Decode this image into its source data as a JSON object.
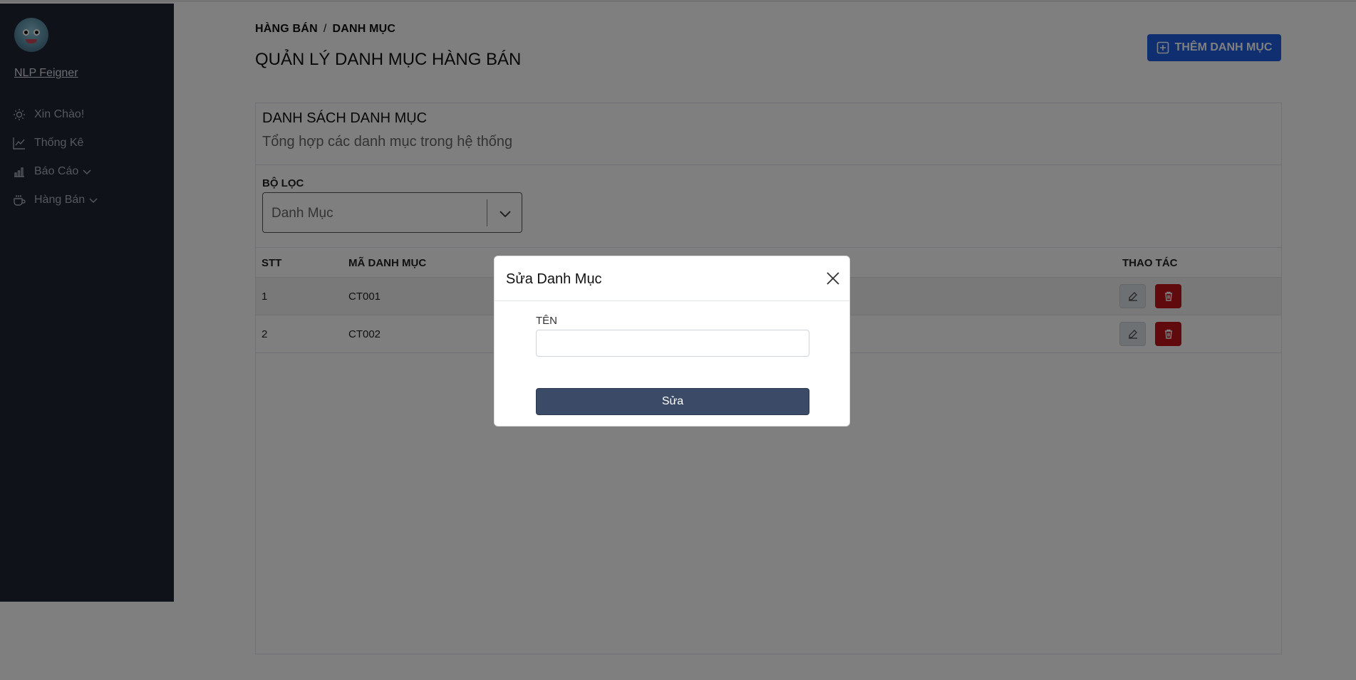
{
  "sidebar": {
    "username": "NLP Feigner",
    "items": [
      {
        "label": "Xin Chào!",
        "icon": "sun-icon"
      },
      {
        "label": "Thống Kê",
        "icon": "chart-line-icon"
      },
      {
        "label": "Báo Cáo",
        "icon": "bar-chart-icon",
        "has_submenu": true
      },
      {
        "label": "Hàng Bán",
        "icon": "cup-icon",
        "has_submenu": true
      }
    ]
  },
  "header": {
    "breadcrumb": [
      "HÀNG BÁN",
      "DANH MỤC"
    ],
    "breadcrumb_separator": "/",
    "title": "QUẢN LÝ DANH MỤC HÀNG BÁN",
    "add_button_label": "THÊM DANH MỤC"
  },
  "card": {
    "title": "DANH SÁCH DANH MỤC",
    "subtitle": "Tổng hợp các danh mục trong hệ thống",
    "filter_label": "BỘ LỌC",
    "filter_value": "Danh Mục"
  },
  "table": {
    "columns": [
      "STT",
      "MÃ DANH MỤC",
      "THAO TÁC"
    ],
    "rows": [
      {
        "stt": "1",
        "code": "CT001"
      },
      {
        "stt": "2",
        "code": "CT002"
      }
    ]
  },
  "modal": {
    "title": "Sửa Danh Mục",
    "field_label": "TÊN",
    "field_value": "",
    "submit_label": "Sửa"
  },
  "colors": {
    "sidebar_bg": "#1e2430",
    "primary": "#1f5fe0",
    "danger": "#c0151b",
    "modal_button": "#3b4a66"
  }
}
